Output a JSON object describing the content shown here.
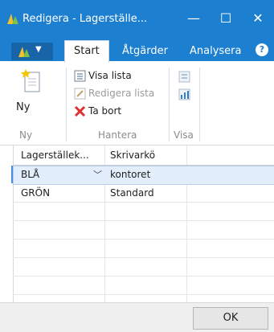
{
  "window": {
    "title": "Redigera - Lagerställe...",
    "minimize": "—",
    "maximize": "☐",
    "close": "✕"
  },
  "ribbon": {
    "tabs": [
      "Start",
      "Åtgärder",
      "Analysera"
    ],
    "active_tab": "Start",
    "groups": {
      "ny": {
        "label": "Ny",
        "new_label": "Ny"
      },
      "hantera": {
        "label": "Hantera",
        "visa_lista": "Visa lista",
        "redigera_lista": "Redigera lista",
        "ta_bort": "Ta bort"
      },
      "visa": {
        "label": "Visa"
      }
    }
  },
  "grid": {
    "columns": [
      "Lagerställek...",
      "Skrivarkö"
    ],
    "rows": [
      {
        "lagerstalle": "BLÅ",
        "skrivarko": "kontoret",
        "selected": true
      },
      {
        "lagerstalle": "GRÖN",
        "skrivarko": "Standard",
        "selected": false
      }
    ]
  },
  "footer": {
    "ok_label": "OK"
  },
  "colors": {
    "titlebar": "#1d7fcf",
    "selection": "#e2eefc",
    "delete_icon": "#e03030"
  }
}
